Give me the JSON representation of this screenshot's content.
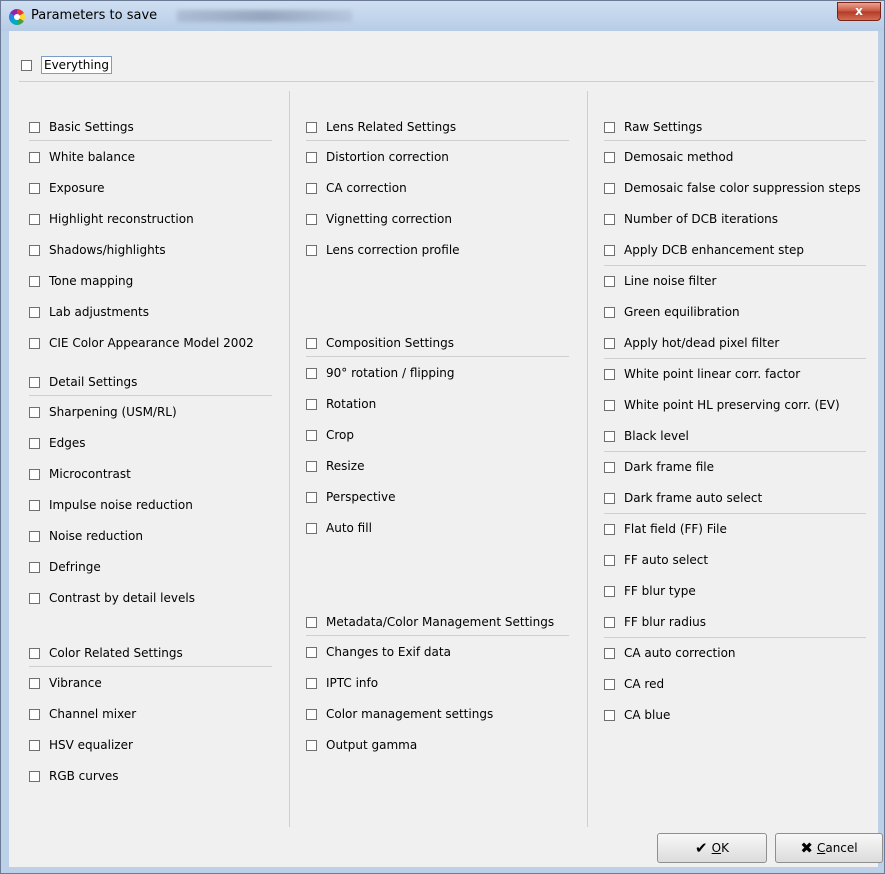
{
  "window": {
    "title": "Parameters to save",
    "close_label": "x"
  },
  "everything_label": "Everything",
  "columns": [
    {
      "sections": [
        {
          "title": "Basic Settings",
          "items": [
            "White balance",
            "Exposure",
            "Highlight reconstruction",
            "Shadows/highlights",
            "Tone mapping",
            "Lab adjustments",
            "CIE Color Appearance Model 2002"
          ]
        },
        {
          "title": "Detail Settings",
          "items": [
            "Sharpening (USM/RL)",
            "Edges",
            "Microcontrast",
            "Impulse noise reduction",
            "Noise reduction",
            "Defringe",
            "Contrast by detail levels"
          ]
        },
        {
          "title": "Color Related Settings",
          "items": [
            "Vibrance",
            "Channel mixer",
            "HSV equalizer",
            "RGB curves"
          ]
        }
      ]
    },
    {
      "sections": [
        {
          "title": "Lens Related Settings",
          "items": [
            "Distortion correction",
            "CA correction",
            "Vignetting correction",
            "Lens correction profile"
          ]
        },
        {
          "title": "Composition Settings",
          "items": [
            "90° rotation / flipping",
            "Rotation",
            "Crop",
            "Resize",
            "Perspective",
            "Auto fill"
          ]
        },
        {
          "title": "Metadata/Color Management Settings",
          "items": [
            "Changes to Exif data",
            "IPTC info",
            "Color management settings",
            "Output gamma"
          ]
        }
      ]
    },
    {
      "sections": [
        {
          "title": "Raw Settings",
          "groups": [
            [
              "Demosaic method",
              "Demosaic false color suppression steps",
              "Number of DCB iterations",
              "Apply DCB enhancement step"
            ],
            [
              "Line noise filter",
              "Green equilibration",
              "Apply hot/dead pixel filter"
            ],
            [
              "White point linear corr. factor",
              "White point HL preserving corr. (EV)",
              "Black level"
            ],
            [
              "Dark frame file",
              "Dark frame auto select"
            ],
            [
              "Flat field (FF) File",
              "FF auto select",
              "FF blur type",
              "FF blur radius"
            ],
            [
              "CA auto correction",
              "CA red",
              "CA blue"
            ]
          ]
        }
      ]
    }
  ],
  "buttons": {
    "ok": {
      "mnemonic": "O",
      "rest": "K",
      "icon": "checkmark-icon"
    },
    "cancel": {
      "mnemonic": "C",
      "rest": "ancel",
      "icon": "x-icon"
    }
  }
}
